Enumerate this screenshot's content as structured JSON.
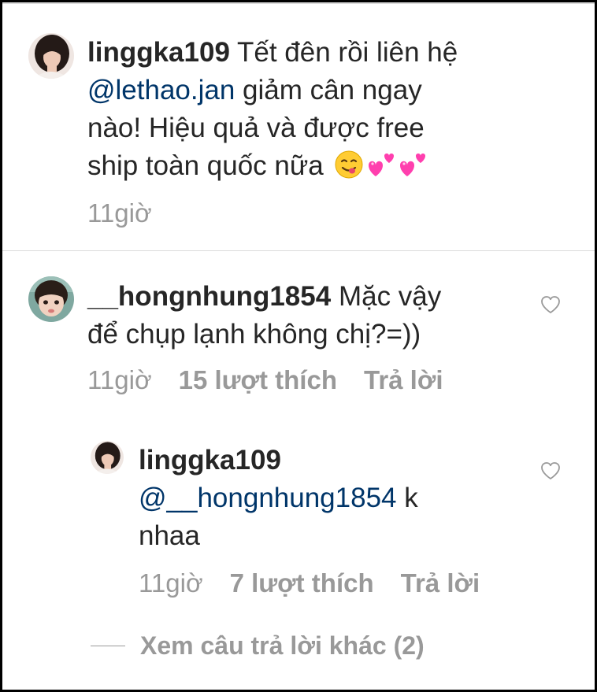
{
  "caption": {
    "username": "linggka109",
    "text_line1": "Tết đên rồi liên hệ",
    "mention": "@lethao.jan",
    "text_line2_rest": " giảm cân ngay",
    "text_line3": "nào! Hiệu quả và được free",
    "text_line4": "ship toàn quốc nữa ",
    "emojis": [
      "yum-emoji",
      "two-hearts-emoji",
      "two-hearts-emoji"
    ],
    "time": "11giờ"
  },
  "comment": {
    "username": "__hongnhung1854",
    "text_line1_rest": " Mặc vậy",
    "text_line2": "để chụp lạnh không chị?=))",
    "time": "11giờ",
    "likes": "15 lượt thích",
    "reply_label": "Trả lời"
  },
  "reply": {
    "username": "linggka109",
    "mention": "@__hongnhung1854",
    "text_line1_rest": " k",
    "text_line2": "nhaa",
    "time": "11giờ",
    "likes": "7 lượt thích",
    "reply_label": "Trả lời"
  },
  "view_more": {
    "label": "Xem câu trả lời khác (2)"
  },
  "colors": {
    "text": "#262626",
    "muted": "#999999",
    "mention": "#003569",
    "divider": "#dbdbdb"
  }
}
